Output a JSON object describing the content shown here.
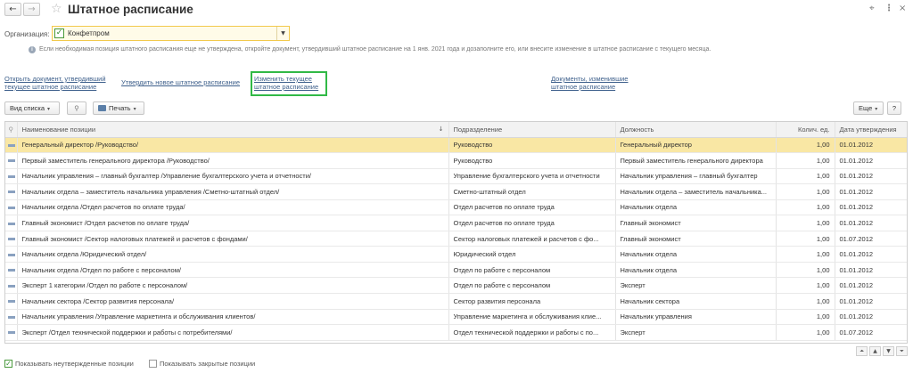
{
  "window": {
    "title": "Штатное расписание",
    "back_icon": "←",
    "forward_icon": "→",
    "star_icon": "☆",
    "link_icon": "⌖",
    "more_icon": "⋮",
    "close_icon": "×"
  },
  "organization": {
    "label": "Организация:",
    "value": "Конфетпром",
    "checked": true,
    "dropdown_icon": "▼"
  },
  "info": {
    "icon": "i",
    "text": "Если необходимая позиция штатного расписания еще не утверждена, откройте документ, утвердивший штатное расписание на 1 янв. 2021 года и дозаполните его, или внесите изменение в штатное расписание с текущего месяца."
  },
  "commands": {
    "open_doc": "Открыть документ, утвердивший текущее штатное расписание",
    "approve_new": "Утвердить новое штатное расписание",
    "change_current": "Изменить текущее штатное расписание",
    "changed_docs": "Документы, изменившие штатное расписание"
  },
  "toolbar": {
    "view_list": "Вид списка",
    "clip_icon": "⚲",
    "print": "Печать",
    "more": "Еще",
    "help": "?",
    "caret": "▾"
  },
  "table": {
    "columns": [
      "Наименование позиции",
      "Подразделение",
      "Должность",
      "Колич. ед.",
      "Дата утверждения"
    ],
    "sort_indicator": "↓",
    "rows": [
      [
        "Генеральный директор /Руководство/",
        "Руководство",
        "Генеральный директор",
        "1,00",
        "01.01.2012"
      ],
      [
        "Первый заместитель генерального директора /Руководство/",
        "Руководство",
        "Первый заместитель генерального директора",
        "1,00",
        "01.01.2012"
      ],
      [
        "Начальник управления – главный бухгалтер /Управление бухгалтерского учета и отчетности/",
        "Управление бухгалтерского учета и отчетности",
        "Начальник управления – главный бухгалтер",
        "1,00",
        "01.01.2012"
      ],
      [
        "Начальник отдела – заместитель начальника управления /Сметно-штатный отдел/",
        "Сметно-штатный отдел",
        "Начальник отдела – заместитель начальника...",
        "1,00",
        "01.01.2012"
      ],
      [
        "Начальник отдела /Отдел расчетов по оплате труда/",
        "Отдел расчетов по оплате труда",
        "Начальник отдела",
        "1,00",
        "01.01.2012"
      ],
      [
        "Главный экономист /Отдел расчетов по оплате труда/",
        "Отдел расчетов по оплате труда",
        "Главный экономист",
        "1,00",
        "01.01.2012"
      ],
      [
        "Главный экономист /Сектор налоговых платежей и расчетов с фондами/",
        "Сектор налоговых платежей и расчетов с фо...",
        "Главный экономист",
        "1,00",
        "01.07.2012"
      ],
      [
        "Начальник отдела /Юридический отдел/",
        "Юридический отдел",
        "Начальник отдела",
        "1,00",
        "01.01.2012"
      ],
      [
        "Начальник отдела /Отдел по работе с персоналом/",
        "Отдел по работе с персоналом",
        "Начальник отдела",
        "1,00",
        "01.01.2012"
      ],
      [
        "Эксперт 1 категории /Отдел по работе с персоналом/",
        "Отдел по работе с персоналом",
        "Эксперт",
        "1,00",
        "01.01.2012"
      ],
      [
        "Начальник сектора /Сектор развития персонала/",
        "Сектор развития персонала",
        "Начальник сектора",
        "1,00",
        "01.01.2012"
      ],
      [
        "Начальник управления /Управление маркетинга и обслуживания клиентов/",
        "Управление маркетинга и обслуживания клие...",
        "Начальник управления",
        "1,00",
        "01.01.2012"
      ],
      [
        "Эксперт /Отдел технической поддержки и работы с потребителями/",
        "Отдел технической поддержки и работы с по...",
        "Эксперт",
        "1,00",
        "01.07.2012"
      ]
    ],
    "selected_row": 0
  },
  "scroll": {
    "first": "⏶",
    "up": "▲",
    "down": "▼",
    "last": "⏷"
  },
  "footer": {
    "show_unapproved": "Показывать неутвержденные позиции",
    "show_unapproved_checked": true,
    "show_closed": "Показывать закрытые позиции",
    "show_closed_checked": false,
    "check_mark": "✓"
  },
  "colors": {
    "selected_row": "#f9e7a4",
    "highlight": "#31b946",
    "link": "#3d5f8b"
  }
}
